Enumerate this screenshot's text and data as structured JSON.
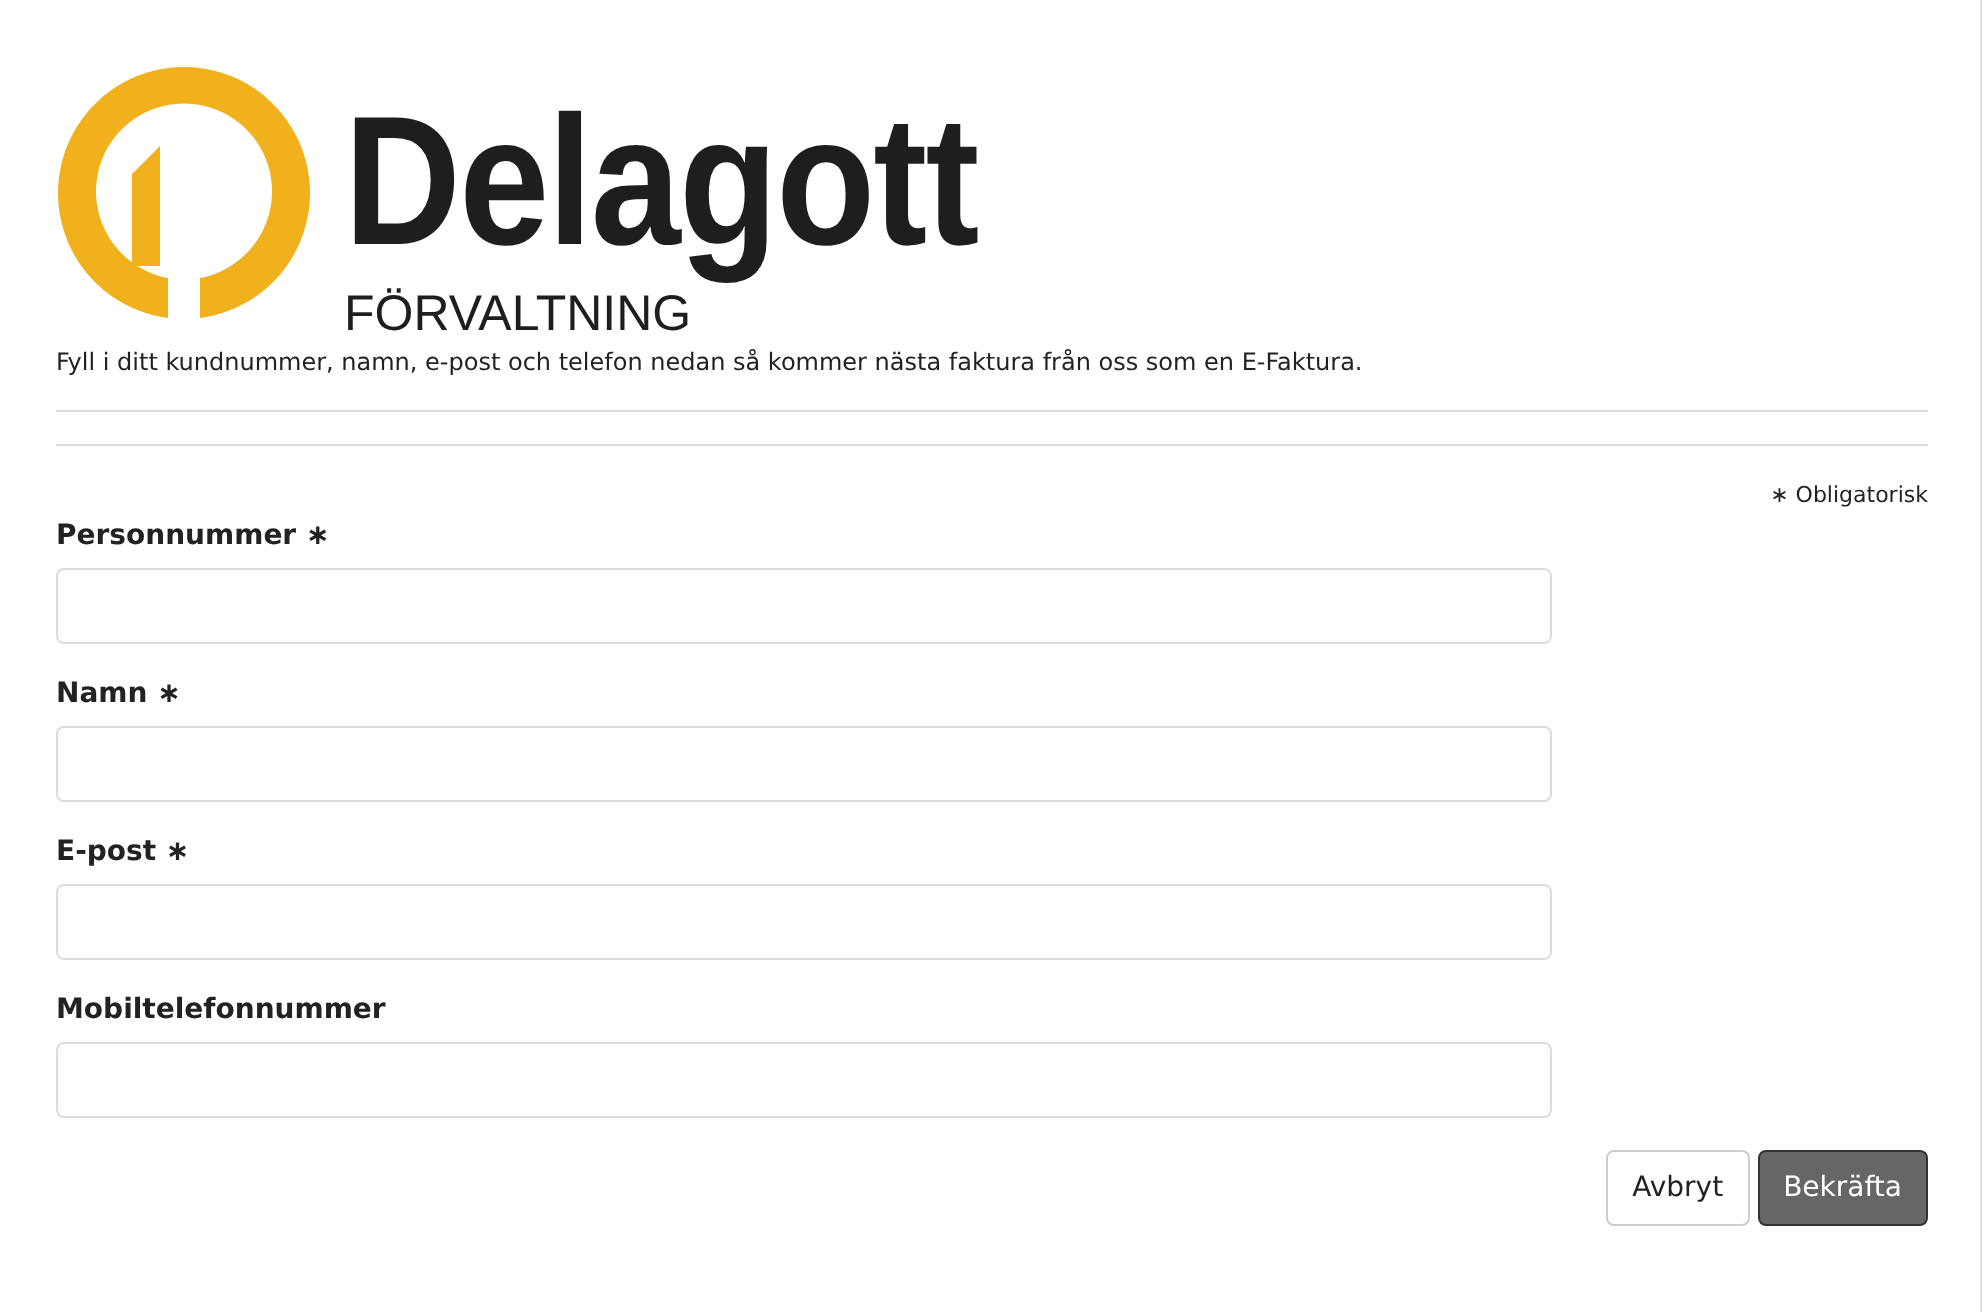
{
  "logo": {
    "name": "Delagott",
    "subtitle": "FÖRVALTNING"
  },
  "intro": "Fyll i ditt kundnummer, namn, e-post och telefon nedan så kommer nästa faktura från oss som en E-Faktura.",
  "required_mark": "∗",
  "legend": "Obligatorisk",
  "fields": [
    {
      "label": "Personnummer",
      "required": true
    },
    {
      "label": "Namn",
      "required": true
    },
    {
      "label": "E-post",
      "required": true
    },
    {
      "label": "Mobiltelefonnummer",
      "required": false
    }
  ],
  "buttons": [
    {
      "label": "Avbryt",
      "kind": "secondary"
    },
    {
      "label": "Bekräfta",
      "kind": "primary"
    }
  ]
}
